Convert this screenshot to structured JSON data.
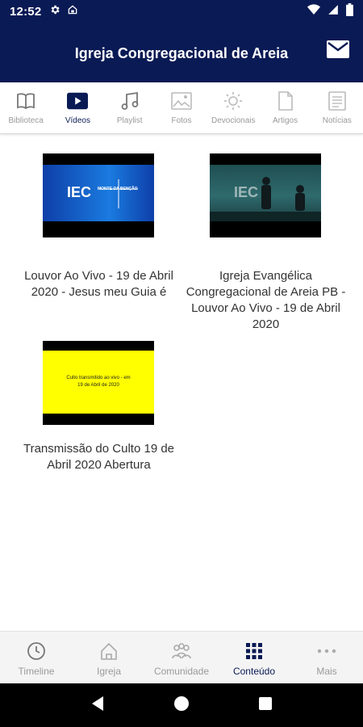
{
  "status_bar": {
    "time": "12:52",
    "icons_left": [
      "gear-icon",
      "home-status-icon"
    ],
    "icons_right": [
      "wifi-icon",
      "signal-icon",
      "battery-icon"
    ]
  },
  "app_bar": {
    "title": "Igreja Congregacional de Areia",
    "action_icon": "mail-icon"
  },
  "tabs": [
    {
      "label": "Biblioteca",
      "icon": "book-icon",
      "active": false
    },
    {
      "label": "Vídeos",
      "icon": "play-icon",
      "active": true
    },
    {
      "label": "Playlist",
      "icon": "music-note-icon",
      "active": false
    },
    {
      "label": "Fotos",
      "icon": "image-icon",
      "active": false
    },
    {
      "label": "Devocionais",
      "icon": "sun-icon",
      "active": false
    },
    {
      "label": "Artigos",
      "icon": "document-icon",
      "active": false
    },
    {
      "label": "Notícias",
      "icon": "news-icon",
      "active": false
    }
  ],
  "videos": [
    {
      "title": "Louvor Ao Vivo - 19 de Abril 2020 - Jesus meu Guia é",
      "thumb_text": "IEC",
      "thumb_subtext": "MONTE DA BENÇÃO"
    },
    {
      "title": "Igreja Evangélica Congregacional de Areia PB - Louvor Ao Vivo - 19 de Abril 2020",
      "thumb_text": "IEC"
    },
    {
      "title": "Transmissão do Culto 19 de Abril 2020 Abertura",
      "thumb_text": "Culto transmitido ao vivo - em 19 de Abril de 2020"
    }
  ],
  "bottom_nav": [
    {
      "label": "Timeline",
      "icon": "clock-icon",
      "active": false
    },
    {
      "label": "Igreja",
      "icon": "church-icon",
      "active": false
    },
    {
      "label": "Comunidade",
      "icon": "people-icon",
      "active": false
    },
    {
      "label": "Conteúdo",
      "icon": "grid-icon",
      "active": true
    },
    {
      "label": "Mais",
      "icon": "more-icon",
      "active": false
    }
  ],
  "colors": {
    "primary": "#0a1a54",
    "inactive": "#9a9a9a",
    "thumb_yellow": "#ffff00",
    "thumb_blue": "#1a5bd6"
  }
}
